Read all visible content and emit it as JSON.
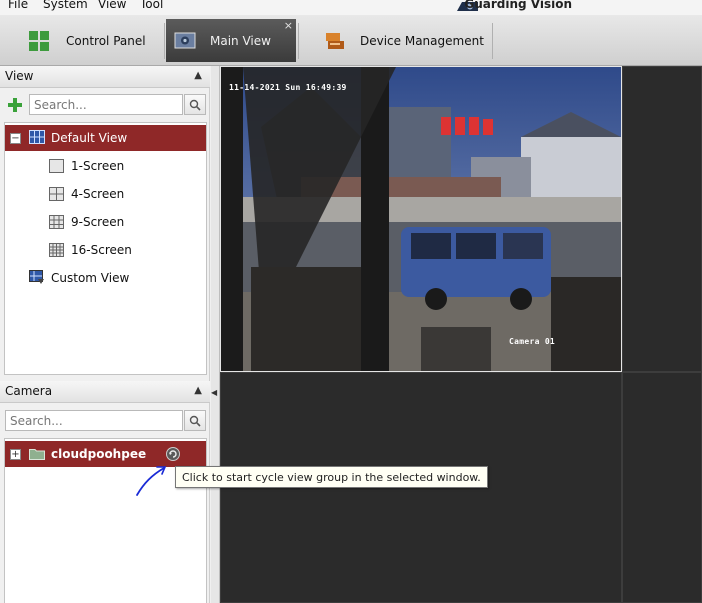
{
  "menu": {
    "items": [
      "File",
      "System",
      "View",
      "Tool"
    ],
    "brand": "Guarding Vision"
  },
  "tabs": [
    {
      "label": "Control Panel",
      "icon": "control-panel-icon",
      "active": false
    },
    {
      "label": "Main View",
      "icon": "main-view-icon",
      "active": true,
      "close": "×"
    },
    {
      "label": "Device Management",
      "icon": "device-management-icon",
      "active": false
    }
  ],
  "view_panel": {
    "title": "View",
    "search_placeholder": "Search...",
    "tree": [
      {
        "label": "Default View",
        "selected": true,
        "expander": "−"
      },
      {
        "label": "1-Screen"
      },
      {
        "label": "4-Screen"
      },
      {
        "label": "9-Screen"
      },
      {
        "label": "16-Screen"
      },
      {
        "label": "Custom View"
      }
    ]
  },
  "camera_panel": {
    "title": "Camera",
    "search_placeholder": "Search...",
    "groups": [
      {
        "label": "cloudpoohpee",
        "selected": true,
        "expander": "+"
      }
    ]
  },
  "video": {
    "timestamp": "11-14-2021 Sun 16:49:39",
    "camera_name": "Camera 01"
  },
  "tooltip": {
    "text": "Click to start cycle view group in the selected window."
  },
  "colors": {
    "selection": "#8f2828",
    "active_tab": "#4a4a4a",
    "video_background": "#2e2e2e"
  }
}
